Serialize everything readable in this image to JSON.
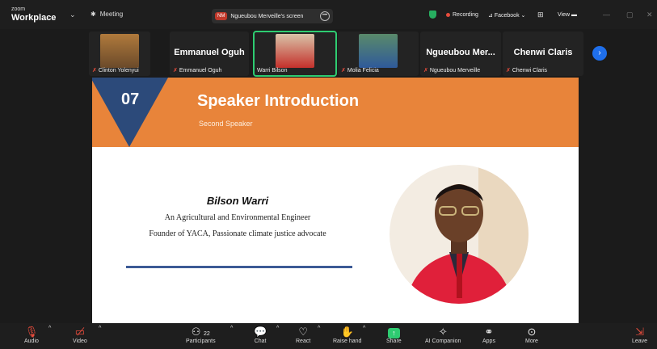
{
  "topbar": {
    "brand_small": "zoom",
    "brand": "Workplace",
    "meeting_label": "Meeting",
    "share_initials": "NM",
    "share_label": "Ngueubou Merveille's screen",
    "recording_label": "Recording",
    "facebook_label": "Facebook",
    "view_label": "View"
  },
  "participants_strip": {
    "tiles": [
      {
        "label": "Clinton Yolenyui",
        "big_name": ""
      },
      {
        "label": "Emmanuel Oguh",
        "big_name": "Emmanuel Oguh"
      },
      {
        "label": "Warri Bilson",
        "big_name": ""
      },
      {
        "label": "Molia Felicia",
        "big_name": ""
      },
      {
        "label": "Ngueubou Merveille",
        "big_name": "Ngueubou  Mer..."
      },
      {
        "label": "Chenwi Claris",
        "big_name": "Chenwi Claris"
      }
    ]
  },
  "slide": {
    "number": "07",
    "title": "Speaker Introduction",
    "subtitle": "Second Speaker",
    "speaker_name": "Bilson Warri",
    "line1": "An Agricultural and Environmental Engineer",
    "line2": "Founder of YACA, Passionate climate justice advocate",
    "colors": {
      "banner": "#e8843a",
      "triangle": "#2c4a7a",
      "rule": "#3c5a96"
    }
  },
  "toolbar": {
    "audio": "Audio",
    "video": "Video",
    "participants": "Participants",
    "participants_count": "22",
    "chat": "Chat",
    "react": "React",
    "raise_hand": "Raise hand",
    "share": "Share",
    "ai_companion": "AI Companion",
    "apps": "Apps",
    "more": "More",
    "leave": "Leave"
  }
}
